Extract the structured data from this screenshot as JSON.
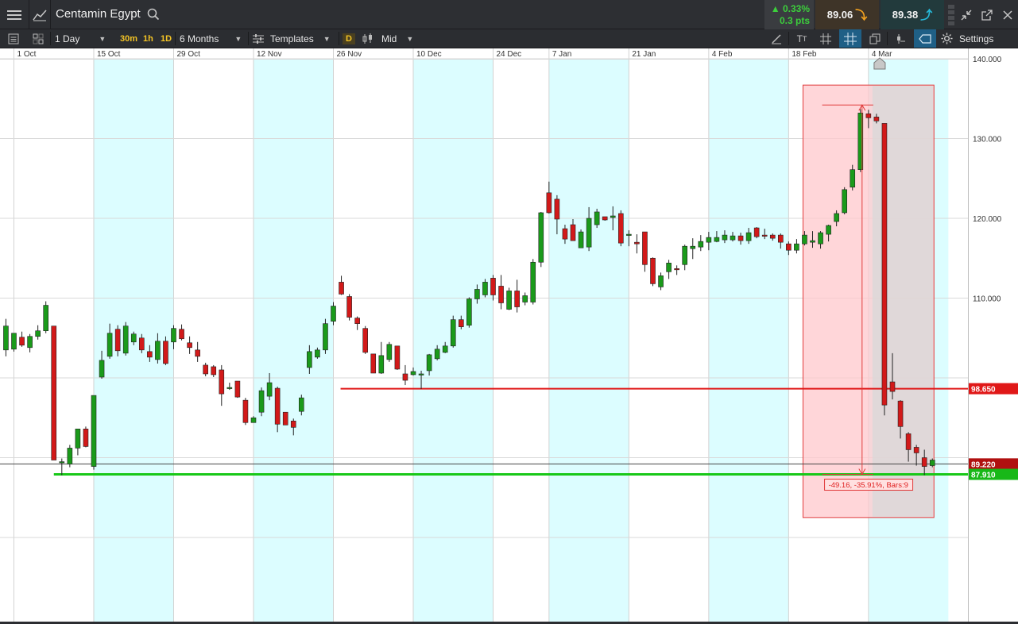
{
  "header": {
    "instrument": "Centamin Egypt",
    "change_pct": "0.33%",
    "change_pts": "0.3 pts",
    "sell_price": "89.06",
    "buy_price": "89.38"
  },
  "toolbar": {
    "interval": "1 Day",
    "quick_30m": "30m",
    "quick_1h": "1h",
    "quick_1d": "1D",
    "range": "6 Months",
    "templates": "Templates",
    "d_label": "D",
    "price_type": "Mid",
    "settings": "Settings"
  },
  "colors": {
    "up": "#1a9a1a",
    "down": "#d21919",
    "band": "#dcfdff",
    "resistance": "#e01818",
    "support": "#18c818",
    "measure_fill": "#ffc8cc"
  },
  "chart_data": {
    "type": "candlestick",
    "y_axis": {
      "min": 75,
      "max": 140,
      "ticks": [
        {
          "value": 140,
          "label": "140.000"
        },
        {
          "value": 130,
          "label": "130.000"
        },
        {
          "value": 120,
          "label": "120.000"
        },
        {
          "value": 110,
          "label": "110.000"
        }
      ]
    },
    "x_axis": {
      "ticks": [
        {
          "index": 0,
          "label": "1 Oct"
        },
        {
          "index": 10,
          "label": "15 Oct"
        },
        {
          "index": 20,
          "label": "29 Oct"
        },
        {
          "index": 30,
          "label": "12 Nov"
        },
        {
          "index": 40,
          "label": "26 Nov"
        },
        {
          "index": 50,
          "label": "10 Dec"
        },
        {
          "index": 60,
          "label": "24 Dec"
        },
        {
          "index": 67,
          "label": "7 Jan"
        },
        {
          "index": 77,
          "label": "21 Jan"
        },
        {
          "index": 87,
          "label": "4 Feb"
        },
        {
          "index": 97,
          "label": "18 Feb"
        },
        {
          "index": 107,
          "label": "4 Mar"
        }
      ]
    },
    "bands": [
      [
        10,
        20
      ],
      [
        30,
        40
      ],
      [
        50,
        60
      ],
      [
        67,
        77
      ],
      [
        87,
        97
      ],
      [
        107,
        117
      ]
    ],
    "candles": [
      [
        -1,
        103.5,
        106.5,
        102.7,
        107.4
      ],
      [
        0,
        103.6,
        105.6,
        103.3,
        105.5
      ],
      [
        1,
        105.1,
        104.1,
        103.9,
        105.8
      ],
      [
        2,
        103.8,
        105.2,
        103.2,
        105.5
      ],
      [
        3,
        105.2,
        105.9,
        104.8,
        106.6
      ],
      [
        4,
        105.9,
        109.1,
        105.6,
        109.6
      ],
      [
        5,
        106.5,
        89.7,
        89.7,
        106.5
      ],
      [
        6,
        89.5,
        89.5,
        87.8,
        89.9
      ],
      [
        7,
        89.2,
        91.2,
        88.8,
        91.6
      ],
      [
        8,
        91.2,
        93.6,
        90.3,
        93.6
      ],
      [
        9,
        93.6,
        91.4,
        91.3,
        93.9
      ],
      [
        10,
        88.9,
        97.8,
        88.5,
        97.8
      ],
      [
        11,
        100.1,
        102.2,
        99.9,
        103.4
      ],
      [
        12,
        102.7,
        105.6,
        102.4,
        106.8
      ],
      [
        13,
        106.1,
        103.4,
        102.7,
        106.6
      ],
      [
        14,
        103.1,
        106.5,
        102.8,
        107.0
      ],
      [
        15,
        104.5,
        105.5,
        104.1,
        105.8
      ],
      [
        16,
        105.0,
        103.5,
        103.1,
        105.5
      ],
      [
        17,
        103.3,
        102.6,
        102.0,
        104.1
      ],
      [
        18,
        102.3,
        104.6,
        101.8,
        105.6
      ],
      [
        19,
        104.6,
        101.8,
        101.6,
        105.2
      ],
      [
        20,
        104.5,
        106.2,
        103.6,
        106.6
      ],
      [
        21,
        106.1,
        104.9,
        104.7,
        106.7
      ],
      [
        22,
        104.4,
        103.8,
        103.0,
        105.2
      ],
      [
        23,
        103.5,
        102.7,
        102.0,
        104.5
      ],
      [
        24,
        101.6,
        100.5,
        100.2,
        101.9
      ],
      [
        25,
        101.4,
        100.4,
        100.1,
        101.6
      ],
      [
        26,
        101.0,
        98.0,
        96.5,
        101.6
      ],
      [
        27,
        98.8,
        98.8,
        98.5,
        99.4
      ],
      [
        28,
        99.6,
        97.6,
        97.5,
        99.6
      ],
      [
        29,
        97.2,
        94.4,
        94.1,
        97.5
      ],
      [
        30,
        94.4,
        95.0,
        94.4,
        95.2
      ],
      [
        31,
        95.7,
        98.4,
        95.2,
        98.8
      ],
      [
        32,
        97.7,
        99.4,
        97.2,
        100.6
      ],
      [
        33,
        98.7,
        94.2,
        93.2,
        98.9
      ],
      [
        34,
        95.7,
        94.1,
        94.1,
        95.7
      ],
      [
        35,
        94.6,
        93.8,
        92.8,
        94.9
      ],
      [
        36,
        95.8,
        97.5,
        95.3,
        97.9
      ],
      [
        37,
        101.3,
        103.3,
        100.5,
        104.1
      ],
      [
        38,
        102.6,
        103.5,
        102.4,
        103.8
      ],
      [
        39,
        103.5,
        106.8,
        103.0,
        107.4
      ],
      [
        40,
        107.1,
        109.0,
        106.6,
        109.5
      ],
      [
        41,
        112.0,
        110.5,
        110.4,
        112.8
      ],
      [
        42,
        110.2,
        107.6,
        107.2,
        110.5
      ],
      [
        43,
        107.5,
        106.8,
        106.0,
        107.7
      ],
      [
        44,
        106.2,
        103.2,
        103.0,
        106.5
      ],
      [
        45,
        103.0,
        100.6,
        100.6,
        103.0
      ],
      [
        46,
        100.6,
        102.8,
        100.5,
        104.5
      ],
      [
        47,
        102.3,
        104.2,
        102.0,
        104.5
      ],
      [
        48,
        104.0,
        101.1,
        101.0,
        104.0
      ],
      [
        49,
        100.5,
        99.7,
        99.1,
        101.6
      ],
      [
        50,
        100.4,
        100.8,
        100.3,
        101.3
      ],
      [
        51,
        100.4,
        100.5,
        98.6,
        100.9
      ],
      [
        52,
        100.9,
        102.9,
        100.3,
        103.0
      ],
      [
        53,
        102.4,
        103.6,
        102.2,
        104.1
      ],
      [
        54,
        103.2,
        104.0,
        103.1,
        104.5
      ],
      [
        55,
        104.0,
        107.3,
        103.8,
        107.8
      ],
      [
        56,
        107.3,
        106.4,
        106.1,
        107.8
      ],
      [
        57,
        106.6,
        109.9,
        106.3,
        110.1
      ],
      [
        58,
        109.9,
        111.1,
        109.3,
        111.7
      ],
      [
        59,
        110.4,
        112.0,
        110.1,
        112.4
      ],
      [
        60,
        112.5,
        110.4,
        109.7,
        112.9
      ],
      [
        61,
        111.5,
        109.4,
        108.6,
        112.9
      ],
      [
        62,
        108.6,
        110.9,
        108.5,
        111.3
      ],
      [
        63,
        110.9,
        108.9,
        108.2,
        112.3
      ],
      [
        64,
        109.5,
        110.3,
        109.1,
        110.7
      ],
      [
        65,
        109.5,
        114.5,
        109.2,
        114.9
      ],
      [
        66,
        114.5,
        120.7,
        113.9,
        120.8
      ],
      [
        67,
        123.2,
        120.7,
        120.6,
        124.6
      ],
      [
        68,
        122.4,
        119.9,
        118.0,
        122.9
      ],
      [
        69,
        118.7,
        117.4,
        116.8,
        119.2
      ],
      [
        70,
        119.2,
        117.2,
        117.2,
        119.9
      ],
      [
        71,
        116.3,
        118.3,
        116.3,
        118.6
      ],
      [
        72,
        116.4,
        120.0,
        115.9,
        121.4
      ],
      [
        73,
        119.2,
        120.8,
        118.8,
        121.2
      ],
      [
        74,
        120.2,
        119.8,
        119.7,
        120.2
      ],
      [
        75,
        120.1,
        120.3,
        118.5,
        121.5
      ],
      [
        76,
        120.6,
        116.9,
        116.5,
        121.0
      ],
      [
        77,
        118.0,
        118.0,
        116.5,
        118.5
      ],
      [
        78,
        117.0,
        116.8,
        115.6,
        118.0
      ],
      [
        79,
        118.3,
        114.2,
        113.3,
        118.3
      ],
      [
        80,
        115.0,
        111.8,
        111.5,
        115.1
      ],
      [
        81,
        111.4,
        112.8,
        111.0,
        113.2
      ],
      [
        82,
        113.3,
        114.4,
        112.4,
        114.8
      ],
      [
        83,
        113.7,
        113.6,
        112.9,
        114.1
      ],
      [
        84,
        114.2,
        116.5,
        113.5,
        116.7
      ],
      [
        85,
        116.2,
        116.5,
        114.9,
        117.5
      ],
      [
        86,
        116.4,
        117.1,
        115.9,
        117.9
      ],
      [
        87,
        117.0,
        117.6,
        116.0,
        118.3
      ],
      [
        88,
        117.1,
        117.6,
        117.0,
        118.4
      ],
      [
        89,
        117.3,
        117.9,
        116.9,
        118.5
      ],
      [
        90,
        117.3,
        117.8,
        117.1,
        118.3
      ],
      [
        91,
        117.8,
        117.2,
        116.7,
        118.2
      ],
      [
        92,
        117.2,
        118.2,
        116.8,
        118.8
      ],
      [
        93,
        118.8,
        117.7,
        117.5,
        118.9
      ],
      [
        94,
        117.9,
        117.8,
        117.4,
        118.7
      ],
      [
        95,
        117.9,
        117.5,
        117.2,
        118.1
      ],
      [
        96,
        117.9,
        117.0,
        116.2,
        118.1
      ],
      [
        97,
        116.8,
        116.0,
        115.4,
        117.1
      ],
      [
        98,
        116.0,
        116.8,
        115.6,
        117.4
      ],
      [
        99,
        116.8,
        117.9,
        116.6,
        118.4
      ],
      [
        100,
        117.0,
        117.2,
        116.3,
        118.4
      ],
      [
        101,
        116.8,
        118.2,
        116.2,
        118.4
      ],
      [
        102,
        118.0,
        119.1,
        117.1,
        119.2
      ],
      [
        103,
        119.6,
        120.6,
        119.0,
        121.0
      ],
      [
        104,
        120.7,
        123.6,
        120.5,
        123.9
      ],
      [
        105,
        123.9,
        126.1,
        123.5,
        126.7
      ],
      [
        106,
        126.1,
        133.2,
        125.8,
        133.7
      ],
      [
        107,
        133.1,
        132.6,
        131.3,
        133.6
      ],
      [
        108,
        132.7,
        132.2,
        131.9,
        133.1
      ],
      [
        109,
        131.9,
        96.6,
        95.3,
        131.9
      ],
      [
        110,
        99.5,
        98.3,
        97.3,
        103.1
      ],
      [
        111,
        97.1,
        93.9,
        92.4,
        97.2
      ],
      [
        112,
        93.0,
        91.0,
        89.5,
        93.2
      ],
      [
        113,
        91.3,
        90.6,
        89.0,
        91.6
      ],
      [
        114,
        90.0,
        88.9,
        87.8,
        91.0
      ],
      [
        115,
        89.0,
        89.7,
        88.8,
        89.9
      ]
    ],
    "horizontal_lines": [
      {
        "value": 98.65,
        "label": "98.650",
        "start_index": 41
      },
      {
        "value": 87.91,
        "label": "87.910",
        "start_index": 5
      }
    ],
    "last_price": {
      "value": 89.22,
      "label": "89.220"
    },
    "measure": {
      "start_index": 99,
      "end_index": 114,
      "top_value": 136.7,
      "bottom_value": 82.5,
      "from_value": 134.2,
      "to_value": 87.91,
      "label": "-49.16, -35.91%, Bars:9"
    }
  }
}
